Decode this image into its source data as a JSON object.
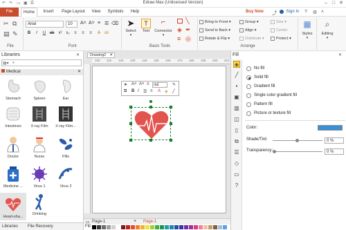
{
  "window": {
    "title": "Edraw Max (Unlicensed Version)",
    "controls": [
      "minimize-icon",
      "maximize-icon",
      "close-icon"
    ]
  },
  "quick_access": [
    "undo-icon",
    "redo-icon",
    "open-icon",
    "save-icon",
    "print-icon"
  ],
  "menu": {
    "file_label": "File",
    "tabs": [
      "Home",
      "Insert",
      "Page Layout",
      "View",
      "Symbols",
      "Help"
    ],
    "buy_now": "Buy Now",
    "sign_in": "Sign In"
  },
  "ribbon": {
    "file_group_label": "File",
    "font_group_label": "Font",
    "font_name": "Arial",
    "font_size": "10",
    "basic_tools_label": "Basic Tools",
    "select_label": "Select",
    "text_label": "Text",
    "connector_label": "Connector",
    "arrange_label": "Arrange",
    "bring_to_front": "Bring to Front",
    "send_to_back": "Send to Back",
    "rotate_flip": "Rotate & Flip",
    "group": "Group",
    "align": "Align",
    "distribute": "Distribute",
    "size": "Size",
    "center": "Center",
    "protect": "Protect",
    "styles_label": "Styles",
    "editing_label": "Editing"
  },
  "libraries": {
    "title": "Libraries",
    "category": "Medical",
    "shapes": [
      "Stomach",
      "Spleen",
      "Ear",
      "Intestines",
      "X-ray Film",
      "X-ray Film...",
      "Doctor",
      "Nurse",
      "Pills",
      "Medicine ...",
      "Virus 1",
      "Virus 2",
      "Heart-sha...",
      "Drinking"
    ],
    "footer": [
      "Libraries",
      "File Recovery"
    ]
  },
  "canvas": {
    "tab": "Drawing2",
    "ruler_ticks": [
      "100",
      "110",
      "120",
      "130",
      "140",
      "150",
      "160",
      "170",
      "180",
      "190",
      "200",
      "210"
    ],
    "mini_font": "rial",
    "pages": [
      "Page-1",
      "Page-1"
    ],
    "fill_label": "Fill"
  },
  "fill_panel": {
    "title": "Fill",
    "options": [
      "No fill",
      "Solid fill",
      "Gradient fill",
      "Single color gradient fill",
      "Pattern fill",
      "Picture or texture fill"
    ],
    "selected": "Solid fill",
    "color_label": "Color:",
    "color_value": "#3a8fd8",
    "shade_label": "Shade/Tint:",
    "shade_value": "0 %",
    "transparency_label": "Transparency:",
    "transparency_value": "0 %"
  },
  "colors": {
    "accent": "#c94c2c",
    "heart": "#e2554e",
    "selection": "#1aa43a"
  }
}
